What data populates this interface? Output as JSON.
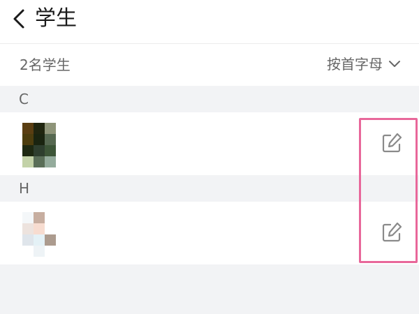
{
  "header": {
    "back_icon": "chevron-left-icon",
    "title": "学生"
  },
  "summary": {
    "count_text": "2名学生",
    "sort_label": "按首字母",
    "sort_icon": "chevron-down-icon"
  },
  "sections": [
    {
      "letter": "C",
      "students": [
        {
          "avatar": "pixelated-avatar-1",
          "edit_icon": "edit-icon"
        }
      ]
    },
    {
      "letter": "H",
      "students": [
        {
          "avatar": "pixelated-avatar-2",
          "edit_icon": "edit-icon"
        }
      ]
    }
  ],
  "colors": {
    "highlight": "#e8679a",
    "background": "#f2f3f5",
    "text_secondary": "#666666"
  }
}
